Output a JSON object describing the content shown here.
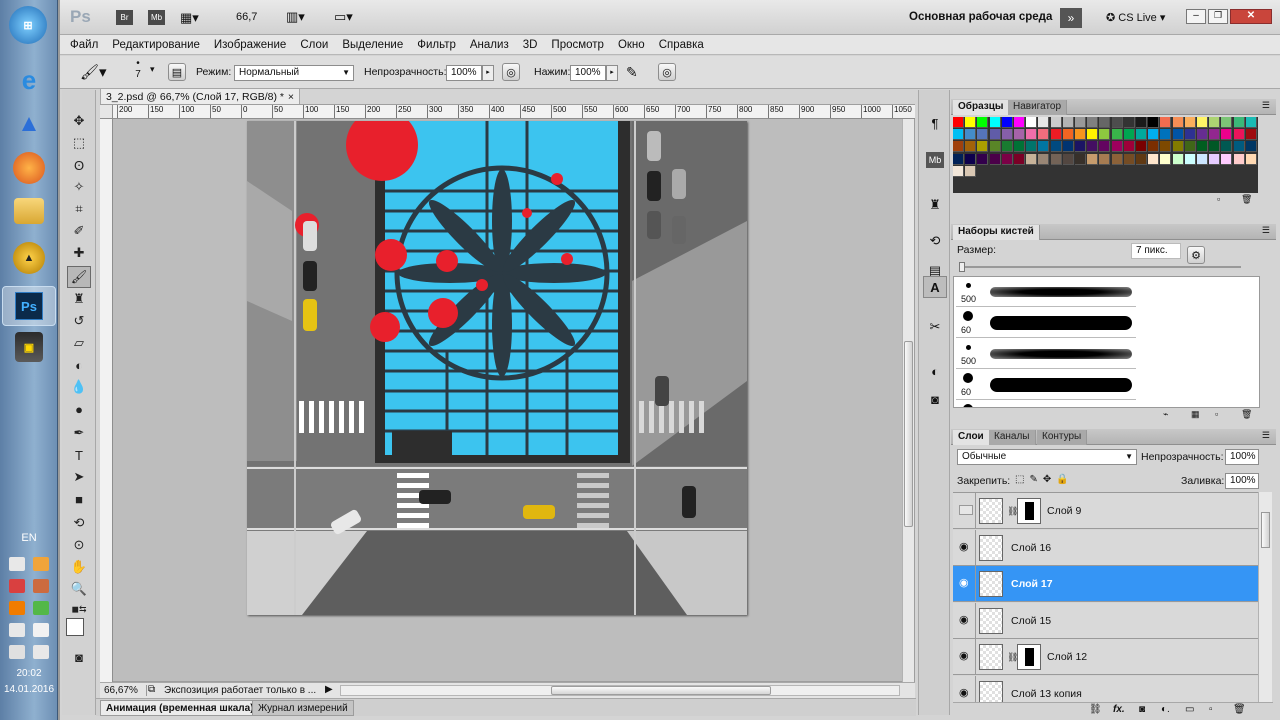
{
  "taskbar": {
    "lang": "EN",
    "time": "20:02",
    "date": "14.01.2016",
    "ps_label": "Ps"
  },
  "appbar": {
    "logo": "Ps",
    "br": "Br",
    "mb": "Mb",
    "zoom": "66,7",
    "workspace": "Основная рабочая среда",
    "cslive": "CS Live"
  },
  "menu": [
    "Файл",
    "Редактирование",
    "Изображение",
    "Слои",
    "Выделение",
    "Фильтр",
    "Анализ",
    "3D",
    "Просмотр",
    "Окно",
    "Справка"
  ],
  "options": {
    "brush_size": "7",
    "mode_label": "Режим:",
    "mode_value": "Нормальный",
    "opacity_label": "Непрозрачность:",
    "opacity_value": "100%",
    "flow_label": "Нажим:",
    "flow_value": "100%"
  },
  "document": {
    "tab_title": "3_2.psd @ 66,7% (Слой 17, RGB/8) *",
    "ruler_marks": [
      "200",
      "150",
      "100",
      "50",
      "0",
      "50",
      "100",
      "150",
      "200",
      "250",
      "300",
      "350",
      "400",
      "450",
      "500",
      "550",
      "600",
      "650",
      "700",
      "750",
      "800",
      "850",
      "900",
      "950",
      "1000",
      "1050"
    ],
    "status_zoom": "66,67%",
    "status_text": "Экспозиция работает только в ..."
  },
  "bottom_tabs": [
    "Анимация (временная шкала)",
    "Журнал измерений"
  ],
  "swatches_panel": {
    "tabs": [
      "Образцы",
      "Навигатор"
    ],
    "colors": [
      "#ff0000",
      "#ffff00",
      "#00ff00",
      "#00ffff",
      "#0000ff",
      "#ff00ff",
      "#ffffff",
      "#e6e6e6",
      "#cccccc",
      "#b3b3b3",
      "#999999",
      "#808080",
      "#666666",
      "#4d4d4d",
      "#333333",
      "#1a1a1a",
      "#000000",
      "#f26c4f",
      "#f68e55",
      "#fbaf5c",
      "#fff467",
      "#acd372",
      "#7cc576",
      "#3bb878",
      "#1abbb4",
      "#00bff3",
      "#438cca",
      "#5574b9",
      "#605ca8",
      "#855fa8",
      "#a763a8",
      "#f06eaa",
      "#f26d7d",
      "#ed1c24",
      "#f26522",
      "#f7941d",
      "#fff200",
      "#8dc73f",
      "#39b54a",
      "#00a651",
      "#00a99d",
      "#00aeef",
      "#0072bc",
      "#0054a6",
      "#2e3192",
      "#662d91",
      "#92278f",
      "#ec008c",
      "#ed145b",
      "#9e0b0f",
      "#a0410d",
      "#a36209",
      "#aba000",
      "#598527",
      "#197b30",
      "#007236",
      "#00746b",
      "#0076a3",
      "#004a80",
      "#003471",
      "#1b1464",
      "#440e62",
      "#630460",
      "#9e005d",
      "#9e0039",
      "#790000",
      "#7b2e00",
      "#7d4900",
      "#827b00",
      "#406618",
      "#005e20",
      "#005826",
      "#005952",
      "#005b7f",
      "#003663",
      "#002157",
      "#0d004c",
      "#32004b",
      "#4b0049",
      "#7b0046",
      "#7a0026",
      "#c7b299",
      "#998675",
      "#736357",
      "#534741",
      "#37302a",
      "#c69c6d",
      "#a67c52",
      "#8c6239",
      "#754c24",
      "#603913",
      "#ffe6cc",
      "#ffffcc",
      "#ccffcc",
      "#ccffff",
      "#cce6ff",
      "#e6ccff",
      "#ffccff",
      "#ffcccc",
      "#ffd9b3",
      "#f2e6d9",
      "#d9c7b3"
    ]
  },
  "brush_panel": {
    "tab": "Наборы кистей",
    "size_label": "Размер:",
    "size_value": "7 пикс.",
    "presets": [
      {
        "size": "500",
        "dot": "small"
      },
      {
        "size": "60",
        "dot": "big"
      },
      {
        "size": "500",
        "dot": "small"
      },
      {
        "size": "60",
        "dot": "big"
      },
      {
        "size": "",
        "dot": "big"
      }
    ]
  },
  "layers_panel": {
    "tabs": [
      "Слои",
      "Каналы",
      "Контуры"
    ],
    "blend_mode": "Обычные",
    "opacity_label": "Непрозрачность:",
    "opacity_value": "100%",
    "lock_label": "Закрепить:",
    "fill_label": "Заливка:",
    "fill_value": "100%",
    "layers": [
      {
        "name": "Слой 9",
        "visible": false,
        "mask": true,
        "selected": false
      },
      {
        "name": "Слой 16",
        "visible": true,
        "mask": false,
        "selected": false
      },
      {
        "name": "Слой 17",
        "visible": true,
        "mask": false,
        "selected": true
      },
      {
        "name": "Слой 15",
        "visible": true,
        "mask": false,
        "selected": false
      },
      {
        "name": "Слой 12",
        "visible": true,
        "mask": true,
        "selected": false
      },
      {
        "name": "Слой 13 копия",
        "visible": true,
        "mask": false,
        "selected": false
      }
    ]
  }
}
